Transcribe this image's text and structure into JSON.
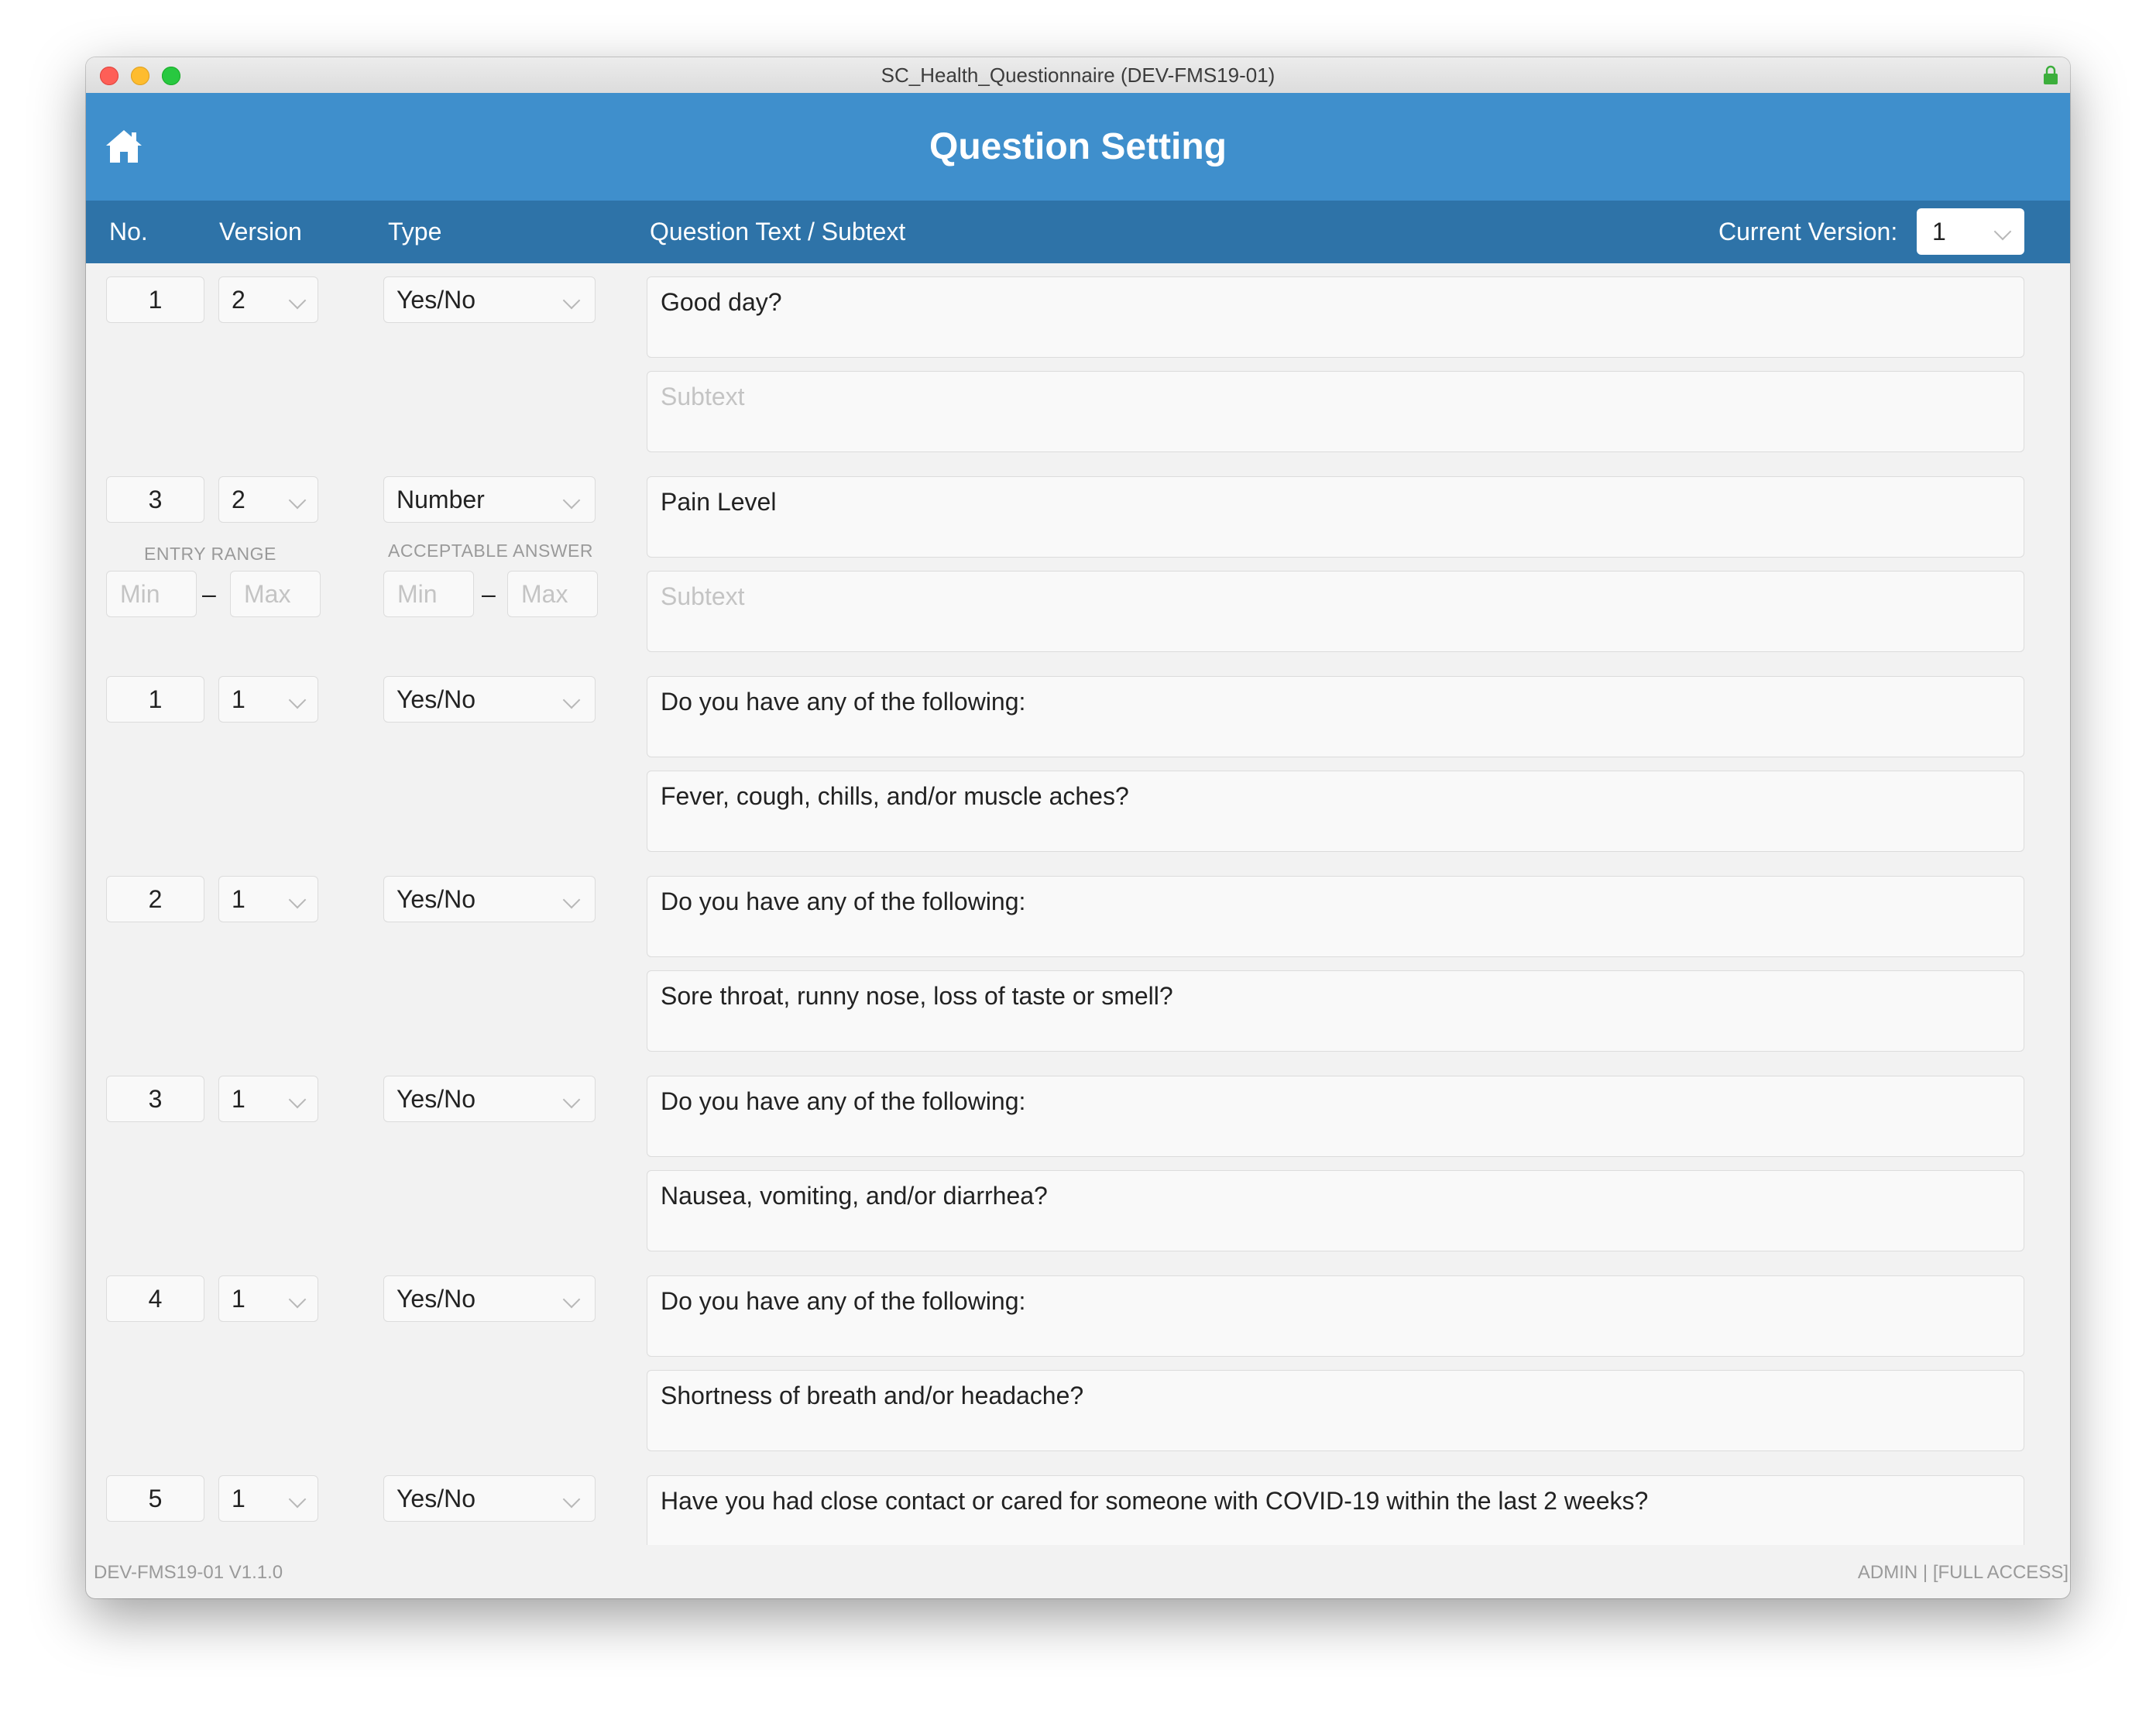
{
  "window": {
    "title": "SC_Health_Questionnaire (DEV-FMS19-01)"
  },
  "header": {
    "title": "Question Setting"
  },
  "columns": {
    "no": "No.",
    "version": "Version",
    "type": "Type",
    "question": "Question Text / Subtext",
    "current_version_label": "Current Version:",
    "current_version_value": "1"
  },
  "number_ranges": {
    "entry_range_label": "ENTRY RANGE",
    "acceptable_answer_label": "ACCEPTABLE ANSWER",
    "min_placeholder": "Min",
    "max_placeholder": "Max",
    "dash": "–"
  },
  "rows": [
    {
      "no": "1",
      "version": "2",
      "type": "Yes/No",
      "question": "Good day?",
      "subtext": ""
    },
    {
      "no": "3",
      "version": "2",
      "type": "Number",
      "question": "Pain Level",
      "subtext": ""
    },
    {
      "no": "1",
      "version": "1",
      "type": "Yes/No",
      "question": "Do you have any of the following:",
      "subtext": "Fever, cough, chills, and/or muscle aches?"
    },
    {
      "no": "2",
      "version": "1",
      "type": "Yes/No",
      "question": "Do you have any of the following:",
      "subtext": "Sore throat, runny nose, loss of taste or smell?"
    },
    {
      "no": "3",
      "version": "1",
      "type": "Yes/No",
      "question": "Do you have any of the following:",
      "subtext": "Nausea, vomiting, and/or diarrhea?"
    },
    {
      "no": "4",
      "version": "1",
      "type": "Yes/No",
      "question": "Do you have any of the following:",
      "subtext": "Shortness of breath and/or headache?"
    },
    {
      "no": "5",
      "version": "1",
      "type": "Yes/No",
      "question": "Have you had close contact or cared for someone with COVID-19 within the last 2 weeks?",
      "subtext": ""
    }
  ],
  "subtext_placeholder": "Subtext",
  "footer": {
    "left": "DEV-FMS19-01 V1.1.0",
    "right": "ADMIN | [FULL ACCESS]"
  }
}
